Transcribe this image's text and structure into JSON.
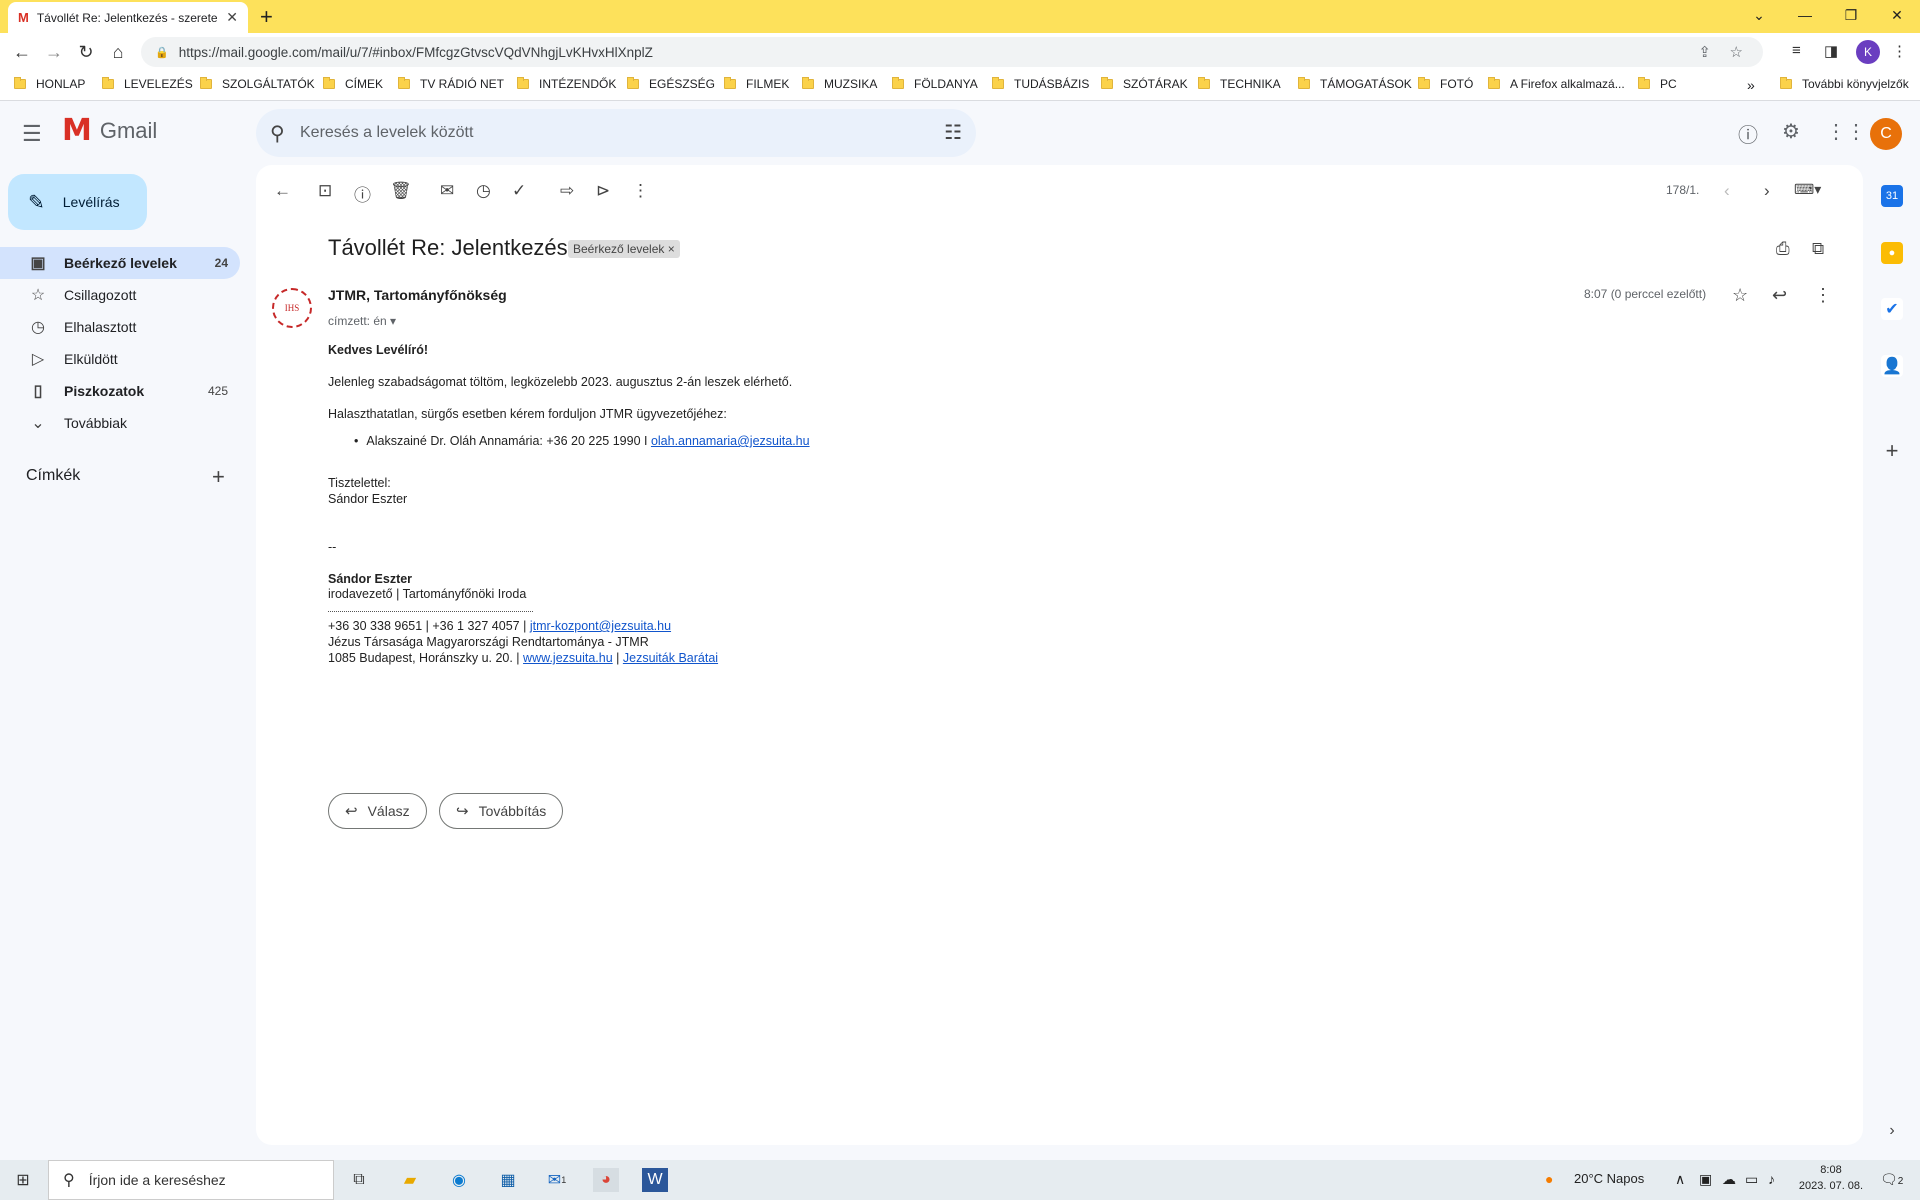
{
  "browser": {
    "tab_title": "Távollét Re: Jelentkezés - szerete",
    "url": "https://mail.google.com/mail/u/7/#inbox/FMfcgzGtvscVQdVNhgjLvKHvxHlXnplZ",
    "profile_initial": "K"
  },
  "bookmarks": [
    "HONLAP",
    "LEVELEZÉS",
    "SZOLGÁLTATÓK",
    "CÍMEK",
    "TV RÁDIÓ NET",
    "INTÉZENDŐK",
    "EGÉSZSÉG",
    "FILMEK",
    "MUZSIKA",
    "FÖLDANYA",
    "TUDÁSBÁZIS",
    "SZÓTÁRAK",
    "TECHNIKA",
    "TÁMOGATÁSOK",
    "FOTÓ",
    "A Firefox alkalmazá...",
    "PC"
  ],
  "bookmarks_more": "»",
  "bookmarks_other": "További könyvjelzők",
  "gmail": {
    "logo_text": "Gmail",
    "search_placeholder": "Keresés a levelek között",
    "avatar_initial": "C",
    "compose_label": "Levélírás",
    "nav": [
      {
        "label": "Beérkező levelek",
        "count": "24"
      },
      {
        "label": "Csillagozott",
        "count": ""
      },
      {
        "label": "Elhalasztott",
        "count": ""
      },
      {
        "label": "Elküldött",
        "count": ""
      },
      {
        "label": "Piszkozatok",
        "count": "425"
      },
      {
        "label": "Továbbiak",
        "count": ""
      }
    ],
    "labels_title": "Címkék",
    "pager": "178/1."
  },
  "email": {
    "subject": "Távollét Re: Jelentkezés",
    "label_chip": "Beérkező levelek",
    "label_close": "×",
    "seal_text": "IHS",
    "sender": "JTMR, Tartományfőnökség",
    "to": "címzett: én",
    "time": "8:07 (0 perccel ezelőtt)",
    "greeting": "Kedves Levélíró!",
    "p1": "Jelenleg szabadságomat töltöm, legközelebb 2023. augusztus 2-án leszek elérhető.",
    "p2": "Halaszthatatlan, sürgős esetben kérem forduljon JTMR ügyvezetőjéhez:",
    "bullet_text": "Alakszainé Dr. Oláh Annamária: +36 20 225 1990 I ",
    "bullet_link": "olah.annamaria@jezsuita.hu",
    "closing": "Tisztelettel:",
    "signer": "Sándor Eszter",
    "dashdash": "--",
    "sig_name": "Sándor Eszter",
    "sig_role": "irodavezető | Tartományfőnöki Iroda",
    "sig_phone": "+36 30 338 9651 | +36 1 327 4057 | ",
    "sig_email": "jtmr-kozpont@jezsuita.hu",
    "sig_org": "Jézus Társasága Magyarországi Rendtartománya - JTMR",
    "sig_addr": "1085 Budapest, Horánszky u. 20. | ",
    "sig_web": "www.jezsuita.hu",
    "sig_sep": " | ",
    "sig_friends": "Jezsuiták Barátai",
    "reply_label": "Válasz",
    "forward_label": "Továbbítás"
  },
  "taskbar": {
    "search_placeholder": "Írjon ide a kereséshez",
    "weather": "20°C  Napos",
    "time": "8:08",
    "date": "2023. 07. 08.",
    "notif_count": "2",
    "mail_badge": "1"
  }
}
